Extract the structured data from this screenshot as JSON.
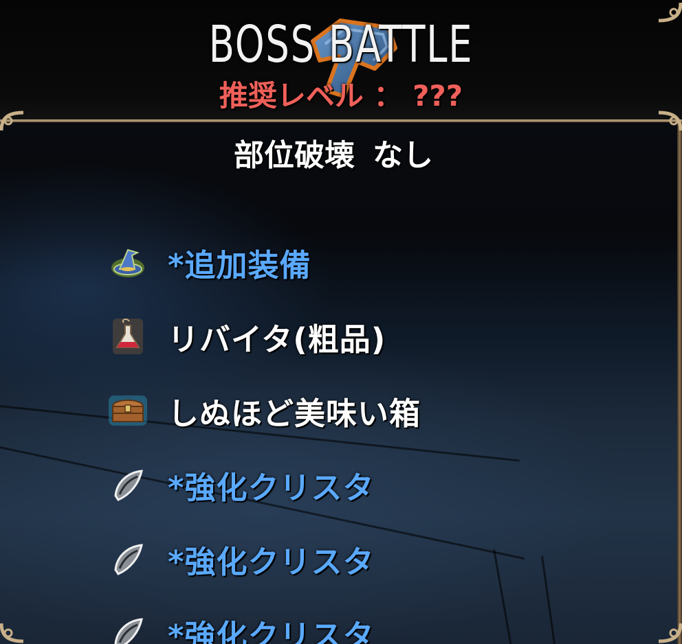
{
  "header": {
    "title": "BOSS  BATTLE",
    "recommended_level": "推奨レベル ： ???"
  },
  "part_break": {
    "label": "部位破壊",
    "value": "なし"
  },
  "rewards": [
    {
      "label": "*追加装備",
      "icon": "wizard-hat-icon",
      "color": "blue"
    },
    {
      "label": "リバイタ(粗品)",
      "icon": "potion-flask-icon",
      "color": "white"
    },
    {
      "label": "しぬほど美味い箱",
      "icon": "treasure-chest-icon",
      "color": "white"
    },
    {
      "label": "*強化クリスタ",
      "icon": "crystal-shard-icon",
      "color": "blue"
    },
    {
      "label": "*強化クリスタ",
      "icon": "crystal-shard-icon",
      "color": "blue"
    },
    {
      "label": "*強化クリスタ",
      "icon": "crystal-shard-icon",
      "color": "blue"
    }
  ],
  "colors": {
    "title": "#f2f2f2",
    "recommended_level": "#f0605a",
    "rare_item": "#5aa9ff",
    "normal_item": "#ffffff",
    "frame_gold": "#c8b089"
  }
}
